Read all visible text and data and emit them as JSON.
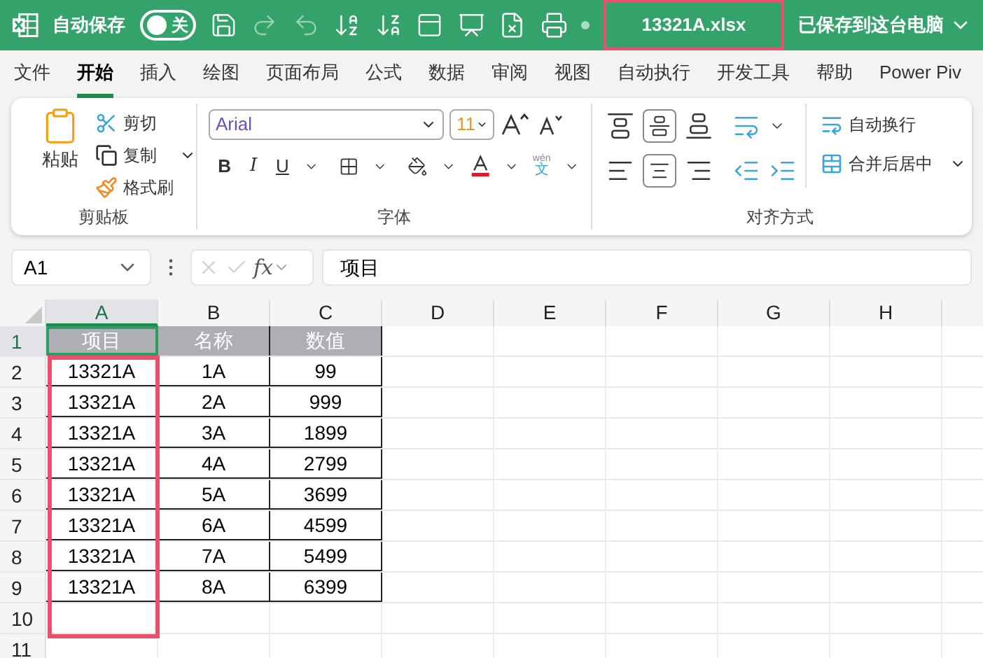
{
  "title_bar": {
    "autosave_label": "自动保存",
    "autosave": {
      "on": false,
      "label": "关"
    },
    "filename": "13321A.xlsx",
    "save_status": "已保存到这台电脑"
  },
  "menu_tabs": [
    {
      "label": "文件",
      "selected": false
    },
    {
      "label": "开始",
      "selected": true
    },
    {
      "label": "插入",
      "selected": false
    },
    {
      "label": "绘图",
      "selected": false
    },
    {
      "label": "页面布局",
      "selected": false
    },
    {
      "label": "公式",
      "selected": false
    },
    {
      "label": "数据",
      "selected": false
    },
    {
      "label": "审阅",
      "selected": false
    },
    {
      "label": "视图",
      "selected": false
    },
    {
      "label": "自动执行",
      "selected": false
    },
    {
      "label": "开发工具",
      "selected": false
    },
    {
      "label": "帮助",
      "selected": false
    },
    {
      "label": "Power Piv",
      "selected": false
    }
  ],
  "ribbon": {
    "clipboard": {
      "paste": "粘贴",
      "cut": "剪切",
      "copy": "复制",
      "format_painter": "格式刷",
      "label": "剪贴板"
    },
    "font": {
      "font_name": "Arial",
      "font_size": "11",
      "bold": "B",
      "italic": "I",
      "underline": "U",
      "pinyin": "wén",
      "pinyin_char": "文",
      "label": "字体"
    },
    "alignment": {
      "wrap_text": "自动换行",
      "merge_center": "合并后居中",
      "label": "对齐方式"
    }
  },
  "formula_bar": {
    "name_box": "A1",
    "fx": "fx",
    "formula": "项目"
  },
  "sheet": {
    "columns": [
      {
        "label": "A",
        "selected": true
      },
      {
        "label": "B",
        "selected": false
      },
      {
        "label": "C",
        "selected": false
      },
      {
        "label": "D",
        "selected": false
      },
      {
        "label": "E",
        "selected": false
      },
      {
        "label": "F",
        "selected": false
      },
      {
        "label": "G",
        "selected": false
      },
      {
        "label": "H",
        "selected": false
      }
    ],
    "rows": [
      {
        "number": "1",
        "selected": true,
        "kind": "header",
        "cells": [
          "项目",
          "名称",
          "数值"
        ]
      },
      {
        "number": "2",
        "selected": false,
        "kind": "data",
        "cells": [
          "13321A",
          "1A",
          "99"
        ]
      },
      {
        "number": "3",
        "selected": false,
        "kind": "data",
        "cells": [
          "13321A",
          "2A",
          "999"
        ]
      },
      {
        "number": "4",
        "selected": false,
        "kind": "data",
        "cells": [
          "13321A",
          "3A",
          "1899"
        ]
      },
      {
        "number": "5",
        "selected": false,
        "kind": "data",
        "cells": [
          "13321A",
          "4A",
          "2799"
        ]
      },
      {
        "number": "6",
        "selected": false,
        "kind": "data",
        "cells": [
          "13321A",
          "5A",
          "3699"
        ]
      },
      {
        "number": "7",
        "selected": false,
        "kind": "data",
        "cells": [
          "13321A",
          "6A",
          "4599"
        ]
      },
      {
        "number": "8",
        "selected": false,
        "kind": "data",
        "cells": [
          "13321A",
          "7A",
          "5499"
        ]
      },
      {
        "number": "9",
        "selected": false,
        "kind": "data",
        "cells": [
          "13321A",
          "8A",
          "6399"
        ]
      },
      {
        "number": "10",
        "selected": false,
        "cells": []
      },
      {
        "number": "11",
        "selected": false,
        "cells": []
      }
    ]
  }
}
